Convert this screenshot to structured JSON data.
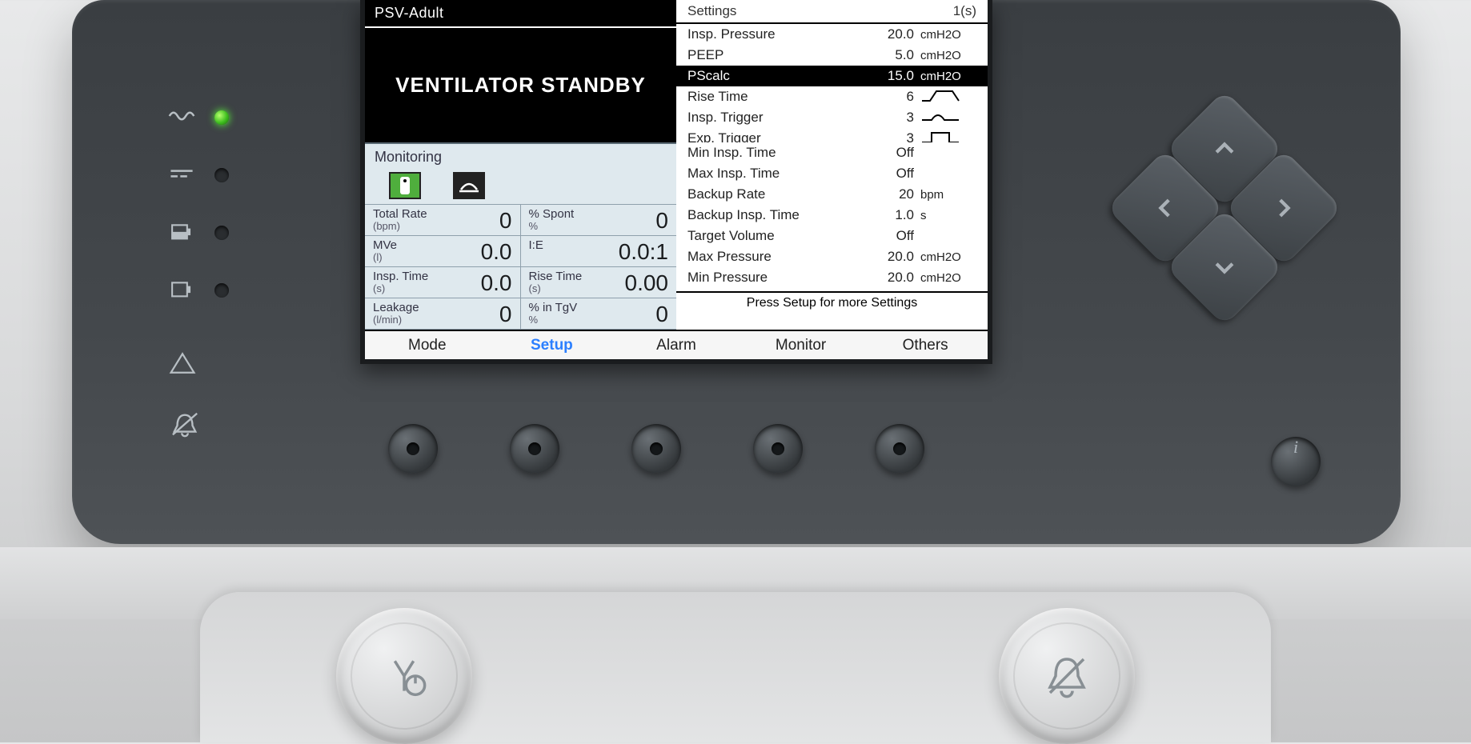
{
  "mode_label": "PSV-Adult",
  "main_status": "VENTILATOR STANDBY",
  "settings_header": {
    "title": "Settings",
    "col": "1(s)"
  },
  "settings": [
    {
      "label": "Insp. Pressure",
      "value": "20.0",
      "unit": "cmH2O",
      "wave": ""
    },
    {
      "label": "PEEP",
      "value": "5.0",
      "unit": "cmH2O",
      "wave": ""
    },
    {
      "label": "PScalc",
      "value": "15.0",
      "unit": "cmH2O",
      "wave": "",
      "selected": true
    },
    {
      "label": "Rise Time",
      "value": "6",
      "unit": "",
      "wave": "ramp"
    },
    {
      "label": "Insp. Trigger",
      "value": "3",
      "unit": "",
      "wave": "sine"
    },
    {
      "label": "Exp. Trigger",
      "value": "3",
      "unit": "",
      "wave": "step"
    },
    {
      "label": "Min Insp. Time",
      "value": "Off",
      "unit": "",
      "wave": ""
    },
    {
      "label": "Max Insp. Time",
      "value": "Off",
      "unit": "",
      "wave": ""
    },
    {
      "label": "Backup Rate",
      "value": "20",
      "unit": "bpm",
      "wave": ""
    },
    {
      "label": "Backup Insp. Time",
      "value": "1.0",
      "unit": "s",
      "wave": ""
    },
    {
      "label": "Target Volume",
      "value": "Off",
      "unit": "",
      "wave": ""
    },
    {
      "label": "Max Pressure",
      "value": "20.0",
      "unit": "cmH2O",
      "wave": ""
    },
    {
      "label": "Min Pressure",
      "value": "20.0",
      "unit": "cmH2O",
      "wave": ""
    }
  ],
  "settings_hint": "Press Setup for more Settings",
  "monitoring_title": "Monitoring",
  "monitoring": [
    {
      "label": "Total Rate",
      "sub": "(bpm)",
      "value": "0"
    },
    {
      "label": "% Spont",
      "sub": "%",
      "value": "0"
    },
    {
      "label": "MVe",
      "sub": "(l)",
      "value": "0.0"
    },
    {
      "label": "I:E",
      "sub": "",
      "value": "0.0:1"
    },
    {
      "label": "Insp. Time",
      "sub": "(s)",
      "value": "0.0"
    },
    {
      "label": "Rise Time",
      "sub": "(s)",
      "value": "0.00"
    },
    {
      "label": "Leakage",
      "sub": "(l/min)",
      "value": "0"
    },
    {
      "label": "% in TgV",
      "sub": "%",
      "value": "0"
    }
  ],
  "tabs": [
    {
      "label": "Mode",
      "active": false
    },
    {
      "label": "Setup",
      "active": true
    },
    {
      "label": "Alarm",
      "active": false
    },
    {
      "label": "Monitor",
      "active": false
    },
    {
      "label": "Others",
      "active": false
    }
  ],
  "side_icons": [
    "ac-power",
    "dc-power",
    "internal-battery",
    "external-battery",
    "alarm-triangle",
    "alarm-silence"
  ],
  "softkey_count": 5,
  "dpad": [
    "up",
    "down",
    "left",
    "right"
  ],
  "bottom_buttons": [
    "power-standby",
    "alarm-silence"
  ]
}
